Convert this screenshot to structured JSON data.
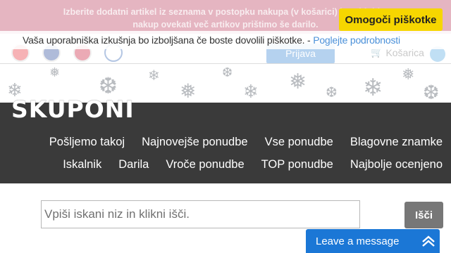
{
  "info_banner": {
    "text_line1": "Izberite dodatni artikel iz seznama v postopku nakupa (v košarici) in pridobite",
    "text_line2": "nakup ovekati več artikov prištimo še darilo."
  },
  "cookie": {
    "message": "Vaša uporabniška izkušnja bo izboljšana če boste dovolili piškotke. - ",
    "link_label": "Poglejte podrobnosti",
    "accept_label": "Omogoči piškotke"
  },
  "header": {
    "login_label": "Prijava",
    "cart_label": "Košarica",
    "cart_icon": "shopping-cart-icon",
    "flags": [
      "flag-hr-icon",
      "flag-gb-icon",
      "flag-no-icon",
      "accessibility-icon"
    ]
  },
  "logo": {
    "text": "SKUPONI"
  },
  "nav": {
    "row1": [
      "Pošljemo takoj",
      "Najnovejše ponudbe",
      "Vse ponudbe",
      "Blagovne znamke"
    ],
    "row2": [
      "Iskalnik",
      "Darila",
      "Vroče ponudbe",
      "TOP ponudbe",
      "Najbolje ocenjeno"
    ]
  },
  "search": {
    "placeholder": "Vpiši iskani niz in klikni išči.",
    "button_label": "Išči"
  },
  "chat": {
    "label": "Leave a message",
    "icon": "expand-icon"
  },
  "colors": {
    "nav_bg": "#3a3a3a",
    "cookie_accept": "#f6d600",
    "chat_bg": "#1b77d6",
    "link": "#4a90d9"
  }
}
